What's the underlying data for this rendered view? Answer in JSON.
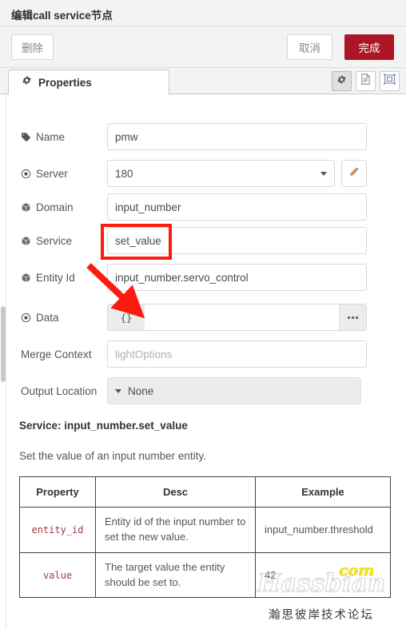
{
  "window": {
    "title": "编辑call service节点"
  },
  "toolbar": {
    "delete_label": "删除",
    "cancel_label": "取消",
    "done_label": "完成",
    "done_color": "#ad1625"
  },
  "tabs": {
    "properties_label": "Properties",
    "icons": [
      "gear-icon",
      "description-icon",
      "appearance-icon"
    ],
    "active": "Properties"
  },
  "form": {
    "fields": [
      {
        "icon": "tag-icon",
        "label": "Name",
        "value": "pmw",
        "placeholder": ""
      },
      {
        "icon": "target-icon",
        "label": "Server",
        "value": "180",
        "placeholder": ""
      },
      {
        "icon": "cube-icon",
        "label": "Domain",
        "value": "input_number",
        "placeholder": ""
      },
      {
        "icon": "cube-icon",
        "label": "Service",
        "value": "set_value",
        "placeholder": ""
      },
      {
        "icon": "cube-icon",
        "label": "Entity Id",
        "value": "input_number.servo_control",
        "placeholder": ""
      },
      {
        "icon": "target-icon",
        "label": "Data",
        "value": "",
        "placeholder": ""
      },
      {
        "icon": "",
        "label": "Merge Context",
        "value": "",
        "placeholder": "lightOptions"
      },
      {
        "icon": "",
        "label": "Output Location",
        "value": "None",
        "placeholder": ""
      }
    ],
    "data_type_badge": "{}",
    "server_edit_icon": "pencil-icon",
    "data_expand_icon": "ellipsis-icon"
  },
  "docs": {
    "heading": "Service: input_number.set_value",
    "description": "Set the value of an input number entity.",
    "table": {
      "headers": [
        "Property",
        "Desc",
        "Example"
      ],
      "rows": [
        {
          "property": "entity_id",
          "desc": "Entity id of the input number to set the new value.",
          "example": "input_number.threshold"
        },
        {
          "property": "value",
          "desc": "The target value the entity should be set to.",
          "example": "42"
        }
      ]
    }
  },
  "annotations": {
    "highlight_color": "#fc1b0f",
    "highlighted_field": "Service",
    "arrow_target": "Data"
  },
  "watermark": {
    "brand": "Hassbian",
    "tld": "com",
    "forum": "瀚思彼岸技术论坛"
  }
}
